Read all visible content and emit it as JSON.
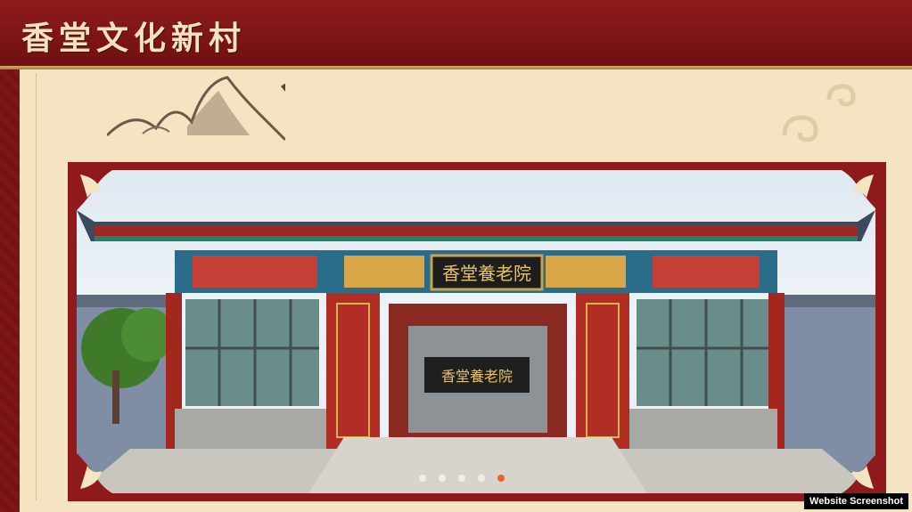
{
  "header": {
    "title": "香堂文化新村"
  },
  "photo": {
    "main_plaque": "香堂養老院",
    "inner_plaque": "香堂養老院",
    "slider": {
      "count": 5,
      "active_index": 4
    }
  },
  "watermark": "Website Screenshot",
  "colors": {
    "brand_red": "#8e1b1d",
    "panel": "#f4e4c2",
    "active_dot": "#e85a16"
  }
}
